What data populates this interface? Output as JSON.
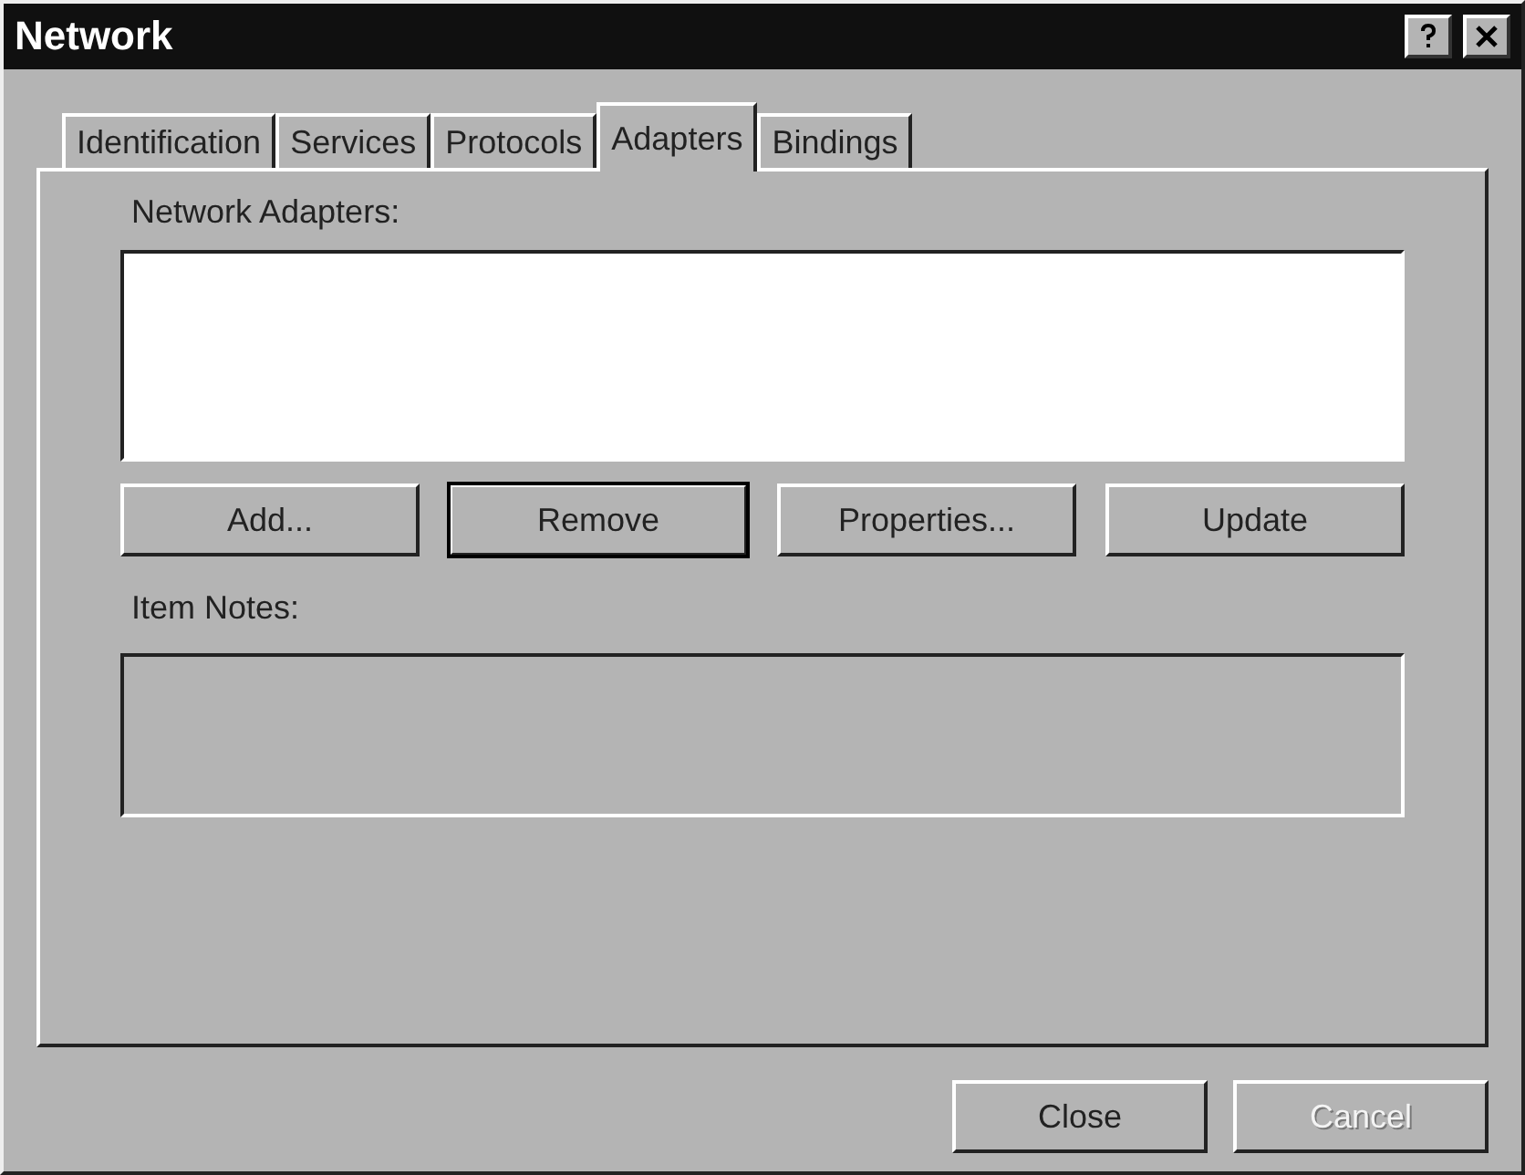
{
  "window": {
    "title": "Network"
  },
  "tabs": [
    {
      "label": "Identification",
      "selected": false
    },
    {
      "label": "Services",
      "selected": false
    },
    {
      "label": "Protocols",
      "selected": false
    },
    {
      "label": "Adapters",
      "selected": true
    },
    {
      "label": "Bindings",
      "selected": false
    }
  ],
  "adapters": {
    "label": "Network Adapters:"
  },
  "actions": [
    {
      "label": "Add...",
      "default": false
    },
    {
      "label": "Remove",
      "default": true
    },
    {
      "label": "Properties...",
      "default": false
    },
    {
      "label": "Update",
      "default": false
    }
  ],
  "item_notes": {
    "label": "Item Notes:"
  },
  "buttons": [
    {
      "label": "Close",
      "disabled": false
    },
    {
      "label": "Cancel",
      "disabled": true
    }
  ]
}
